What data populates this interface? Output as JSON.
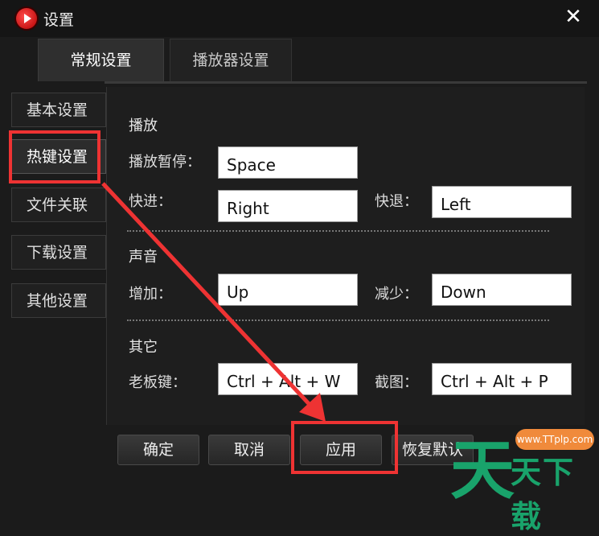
{
  "window": {
    "title": "设置"
  },
  "tabs": [
    {
      "label": "常规设置"
    },
    {
      "label": "播放器设置"
    }
  ],
  "sidebar": {
    "items": [
      {
        "label": "基本设置"
      },
      {
        "label": "热键设置"
      },
      {
        "label": "文件关联"
      },
      {
        "label": "下载设置"
      },
      {
        "label": "其他设置"
      }
    ]
  },
  "playback": {
    "section": "播放",
    "pause_label": "播放暂停：",
    "pause_value": "Space",
    "forward_label": "快进：",
    "forward_value": "Right",
    "rewind_label": "快退：",
    "rewind_value": "Left"
  },
  "sound": {
    "section": "声音",
    "increase_label": "增加：",
    "increase_value": "Up",
    "decrease_label": "减少：",
    "decrease_value": "Down"
  },
  "other": {
    "section": "其它",
    "boss_label": "老板键：",
    "boss_value": "Ctrl + Alt + W",
    "screenshot_label": "截图：",
    "screenshot_value": "Ctrl + Alt + P"
  },
  "buttons": {
    "ok": "确定",
    "cancel": "取消",
    "apply": "应用",
    "restore": "恢复默认"
  },
  "watermark": {
    "tag": "www.TTplp.com",
    "big": "天",
    "small": "天下载"
  },
  "colors": {
    "highlight": "#e33333",
    "watermark": "#19a36b"
  }
}
